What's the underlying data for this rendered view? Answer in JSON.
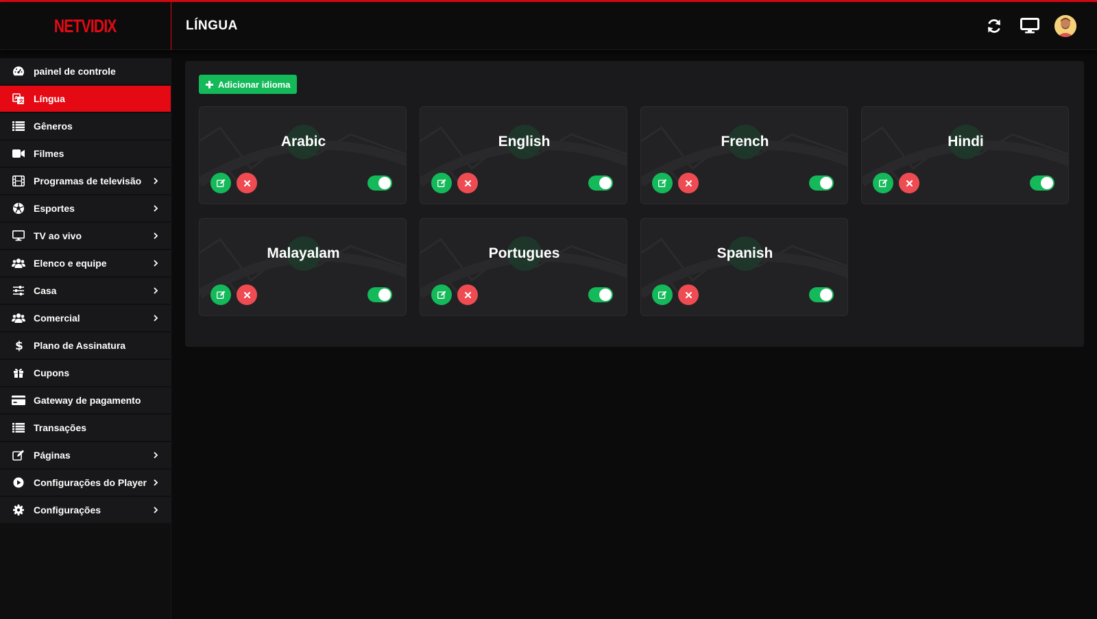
{
  "brand": {
    "logo_text": "NETVIDIX",
    "accent": "#e50914"
  },
  "header": {
    "title": "LÍNGUA",
    "icons": [
      "refresh-icon",
      "monitor-icon",
      "user-avatar"
    ]
  },
  "sidebar": {
    "items": [
      {
        "label": "painel de controle",
        "icon": "dashboard-icon",
        "active": false,
        "has_children": false
      },
      {
        "label": "Língua",
        "icon": "language-icon",
        "active": true,
        "has_children": false
      },
      {
        "label": "Gêneros",
        "icon": "list-icon",
        "active": false,
        "has_children": false
      },
      {
        "label": "Filmes",
        "icon": "video-camera-icon",
        "active": false,
        "has_children": false
      },
      {
        "label": "Programas de televisão",
        "icon": "film-icon",
        "active": false,
        "has_children": true
      },
      {
        "label": "Esportes",
        "icon": "soccer-ball-icon",
        "active": false,
        "has_children": true
      },
      {
        "label": "TV ao vivo",
        "icon": "tv-icon",
        "active": false,
        "has_children": true
      },
      {
        "label": "Elenco e equipe",
        "icon": "users-icon",
        "active": false,
        "has_children": true
      },
      {
        "label": "Casa",
        "icon": "sliders-icon",
        "active": false,
        "has_children": true
      },
      {
        "label": "Comercial",
        "icon": "users-icon",
        "active": false,
        "has_children": true
      },
      {
        "label": "Plano de Assinatura",
        "icon": "dollar-icon",
        "active": false,
        "has_children": false
      },
      {
        "label": "Cupons",
        "icon": "gift-icon",
        "active": false,
        "has_children": false
      },
      {
        "label": "Gateway de pagamento",
        "icon": "credit-card-icon",
        "active": false,
        "has_children": false
      },
      {
        "label": "Transações",
        "icon": "list-icon",
        "active": false,
        "has_children": false
      },
      {
        "label": "Páginas",
        "icon": "edit-icon",
        "active": false,
        "has_children": true
      },
      {
        "label": "Configurações do Player",
        "icon": "play-circle-icon",
        "active": false,
        "has_children": true
      },
      {
        "label": "Configurações",
        "icon": "gear-icon",
        "active": false,
        "has_children": true
      }
    ]
  },
  "main": {
    "add_button_label": "Adicionar idioma",
    "languages": [
      {
        "name": "Arabic",
        "enabled": true
      },
      {
        "name": "English",
        "enabled": true
      },
      {
        "name": "French",
        "enabled": true
      },
      {
        "name": "Hindi",
        "enabled": true
      },
      {
        "name": "Malayalam",
        "enabled": true
      },
      {
        "name": "Portugues",
        "enabled": true
      },
      {
        "name": "Spanish",
        "enabled": true
      }
    ]
  },
  "colors": {
    "success": "#14b95a",
    "danger": "#ef4b52",
    "panel": "#1a1a1c",
    "card": "#222224"
  }
}
